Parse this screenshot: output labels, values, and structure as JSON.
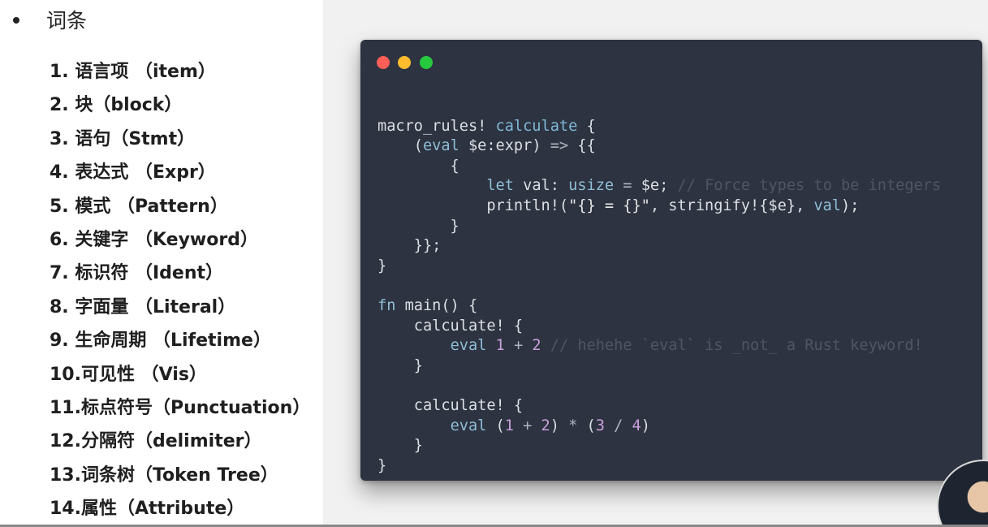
{
  "slide": {
    "title": "词条",
    "terms": [
      "1.  语言项 （item）",
      "2.  块（block）",
      "3.  语句（Stmt）",
      "4.  表达式 （Expr）",
      "5.  模式 （Pattern）",
      "6.  关键字 （Keyword）",
      "7.  标识符 （Ident）",
      "8.  字面量 （Literal）",
      "9.  生命周期 （Lifetime）",
      "10.可见性  （Vis）",
      "11.标点符号（Punctuation）",
      "12.分隔符（delimiter）",
      "13.词条树（Token Tree）",
      "14.属性（Attribute）"
    ]
  },
  "code_window": {
    "colors": {
      "background": "#2d3340",
      "close": "#ff5f56",
      "minimize": "#ffbd2e",
      "maximize": "#27c93f"
    },
    "lines": [
      [
        {
          "t": "",
          "c": ""
        }
      ],
      [
        {
          "t": "macro_rules! ",
          "c": ""
        },
        {
          "t": "calculate",
          "c": "tk-fn"
        },
        {
          "t": " {",
          "c": ""
        }
      ],
      [
        {
          "t": "    (",
          "c": ""
        },
        {
          "t": "eval",
          "c": "tk-kw"
        },
        {
          "t": " $e:expr) ",
          "c": ""
        },
        {
          "t": "=>",
          "c": "tk-op"
        },
        {
          "t": " {{",
          "c": ""
        }
      ],
      [
        {
          "t": "        {",
          "c": ""
        }
      ],
      [
        {
          "t": "            ",
          "c": ""
        },
        {
          "t": "let",
          "c": "tk-kw"
        },
        {
          "t": " val: ",
          "c": ""
        },
        {
          "t": "usize",
          "c": "tk-kw"
        },
        {
          "t": " ",
          "c": ""
        },
        {
          "t": "=",
          "c": "tk-op"
        },
        {
          "t": " $e; ",
          "c": ""
        },
        {
          "t": "// Force types to be integers",
          "c": "tk-cm"
        }
      ],
      [
        {
          "t": "            println!(",
          "c": ""
        },
        {
          "t": "\"{} = {}\"",
          "c": "tk-str"
        },
        {
          "t": ", stringify!{$e}, ",
          "c": ""
        },
        {
          "t": "val",
          "c": "tk-kw"
        },
        {
          "t": ");",
          "c": ""
        }
      ],
      [
        {
          "t": "        }",
          "c": ""
        }
      ],
      [
        {
          "t": "    }};",
          "c": ""
        }
      ],
      [
        {
          "t": "}",
          "c": ""
        }
      ],
      [
        {
          "t": "",
          "c": ""
        }
      ],
      [
        {
          "t": "fn",
          "c": "tk-kw"
        },
        {
          "t": " main() {",
          "c": ""
        }
      ],
      [
        {
          "t": "    calculate! {",
          "c": ""
        }
      ],
      [
        {
          "t": "        ",
          "c": ""
        },
        {
          "t": "eval",
          "c": "tk-kw"
        },
        {
          "t": " ",
          "c": ""
        },
        {
          "t": "1",
          "c": "tk-num"
        },
        {
          "t": " ",
          "c": ""
        },
        {
          "t": "+",
          "c": "tk-op"
        },
        {
          "t": " ",
          "c": ""
        },
        {
          "t": "2",
          "c": "tk-num"
        },
        {
          "t": " ",
          "c": ""
        },
        {
          "t": "// hehehe `eval` is _not_ a Rust keyword!",
          "c": "tk-cm"
        }
      ],
      [
        {
          "t": "    }",
          "c": ""
        }
      ],
      [
        {
          "t": "",
          "c": ""
        }
      ],
      [
        {
          "t": "    calculate! {",
          "c": ""
        }
      ],
      [
        {
          "t": "        ",
          "c": ""
        },
        {
          "t": "eval",
          "c": "tk-kw"
        },
        {
          "t": " (",
          "c": ""
        },
        {
          "t": "1",
          "c": "tk-num"
        },
        {
          "t": " ",
          "c": ""
        },
        {
          "t": "+",
          "c": "tk-op"
        },
        {
          "t": " ",
          "c": ""
        },
        {
          "t": "2",
          "c": "tk-num"
        },
        {
          "t": ") ",
          "c": ""
        },
        {
          "t": "*",
          "c": "tk-op"
        },
        {
          "t": " (",
          "c": ""
        },
        {
          "t": "3",
          "c": "tk-num"
        },
        {
          "t": " ",
          "c": ""
        },
        {
          "t": "/",
          "c": "tk-op"
        },
        {
          "t": " ",
          "c": ""
        },
        {
          "t": "4",
          "c": "tk-num"
        },
        {
          "t": ")",
          "c": ""
        }
      ],
      [
        {
          "t": "    }",
          "c": ""
        }
      ],
      [
        {
          "t": "}",
          "c": ""
        }
      ]
    ]
  },
  "overlay": {
    "logo_icon": "brand-logo-icon",
    "avatar_icon": "presenter-avatar"
  }
}
